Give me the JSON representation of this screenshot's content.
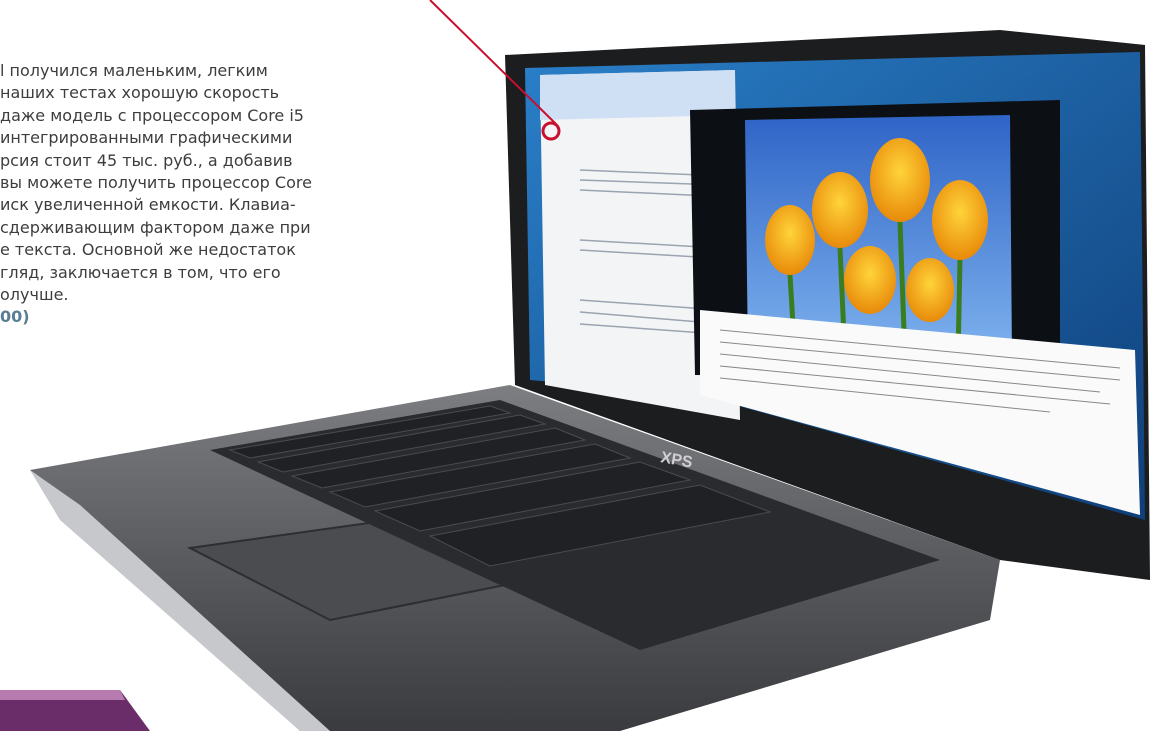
{
  "article": {
    "lines": [
      "l получился маленьким, легким",
      "наших тестах хорошую скорость",
      "даже модель с процессором Core i5",
      "интегрированными графическими",
      "рсия стоит 45 тыс. руб., а добавив",
      "вы можете получить процессор Core",
      "иск увеличенной емкости. Клавиа-",
      "сдерживающим фактором даже при",
      "е текста. Основной же недостаток",
      "гляд, заключается в том, что его",
      "олучше."
    ],
    "price_fragment": "00)"
  },
  "laptop": {
    "brand": "XPS"
  },
  "colors": {
    "body_text": "#3d3d3d",
    "price_text": "#5b7c93",
    "callout_red": "#c8102e"
  }
}
